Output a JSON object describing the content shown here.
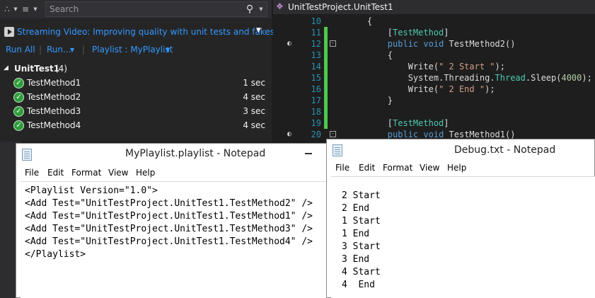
{
  "explorer": {
    "search_placeholder": "Search",
    "video_link": "Streaming Video: Improving quality with unit tests and fakes",
    "run_all": "Run All",
    "run": "Run...",
    "playlist": "Playlist : MyPlaylist",
    "group": {
      "name": "UnitTest1",
      "count": "(4)"
    },
    "tests": [
      {
        "name": "TestMethod1",
        "duration": "1 sec"
      },
      {
        "name": "TestMethod2",
        "duration": "4 sec"
      },
      {
        "name": "TestMethod3",
        "duration": "3 sec"
      },
      {
        "name": "TestMethod4",
        "duration": "4 sec"
      }
    ]
  },
  "editor": {
    "nav_title": "UnitTestProject.UnitTest1",
    "lines": [
      {
        "num": "10"
      },
      {
        "num": "11"
      },
      {
        "num": "12"
      },
      {
        "num": "13"
      },
      {
        "num": "14"
      },
      {
        "num": "15"
      },
      {
        "num": "16"
      },
      {
        "num": "17"
      },
      {
        "num": "18"
      },
      {
        "num": "19"
      },
      {
        "num": "20"
      }
    ],
    "code": {
      "brace_open": "{",
      "attr_open": "[",
      "attr_name": "TestMethod",
      "attr_close": "]",
      "public": "public",
      "void": "void",
      "method2": "TestMethod2()",
      "method1": "TestMethod1()",
      "write": "Write(",
      "str_2start": "\" 2 Start \"",
      "str_2end": "\" 2 End \"",
      "close_paren": ");",
      "system": "System.",
      "threading": "Threading.",
      "thread": "Thread",
      "sleep": ".Sleep(",
      "sleep_ms": "4000",
      "brace_close": "}"
    }
  },
  "playlist_notepad": {
    "title": "MyPlaylist.playlist - Notepad",
    "menu": [
      "File",
      "Edit",
      "Format",
      "View",
      "Help"
    ],
    "lines": [
      "<Playlist Version=\"1.0\">",
      "<Add Test=\"UnitTestProject.UnitTest1.TestMethod2\" />",
      "<Add Test=\"UnitTestProject.UnitTest1.TestMethod1\" />",
      "<Add Test=\"UnitTestProject.UnitTest1.TestMethod3\" />",
      "<Add Test=\"UnitTestProject.UnitTest1.TestMethod4\" />",
      "</Playlist>"
    ]
  },
  "debug_notepad": {
    "title": "Debug.txt - Notepad",
    "menu": [
      "File",
      "Edit",
      "Format",
      "View",
      "Help"
    ],
    "lines": [
      "2 Start",
      "2 End",
      "1 Start",
      "1 End",
      "3 Start",
      "3 End",
      "4 Start",
      "4  End"
    ]
  }
}
